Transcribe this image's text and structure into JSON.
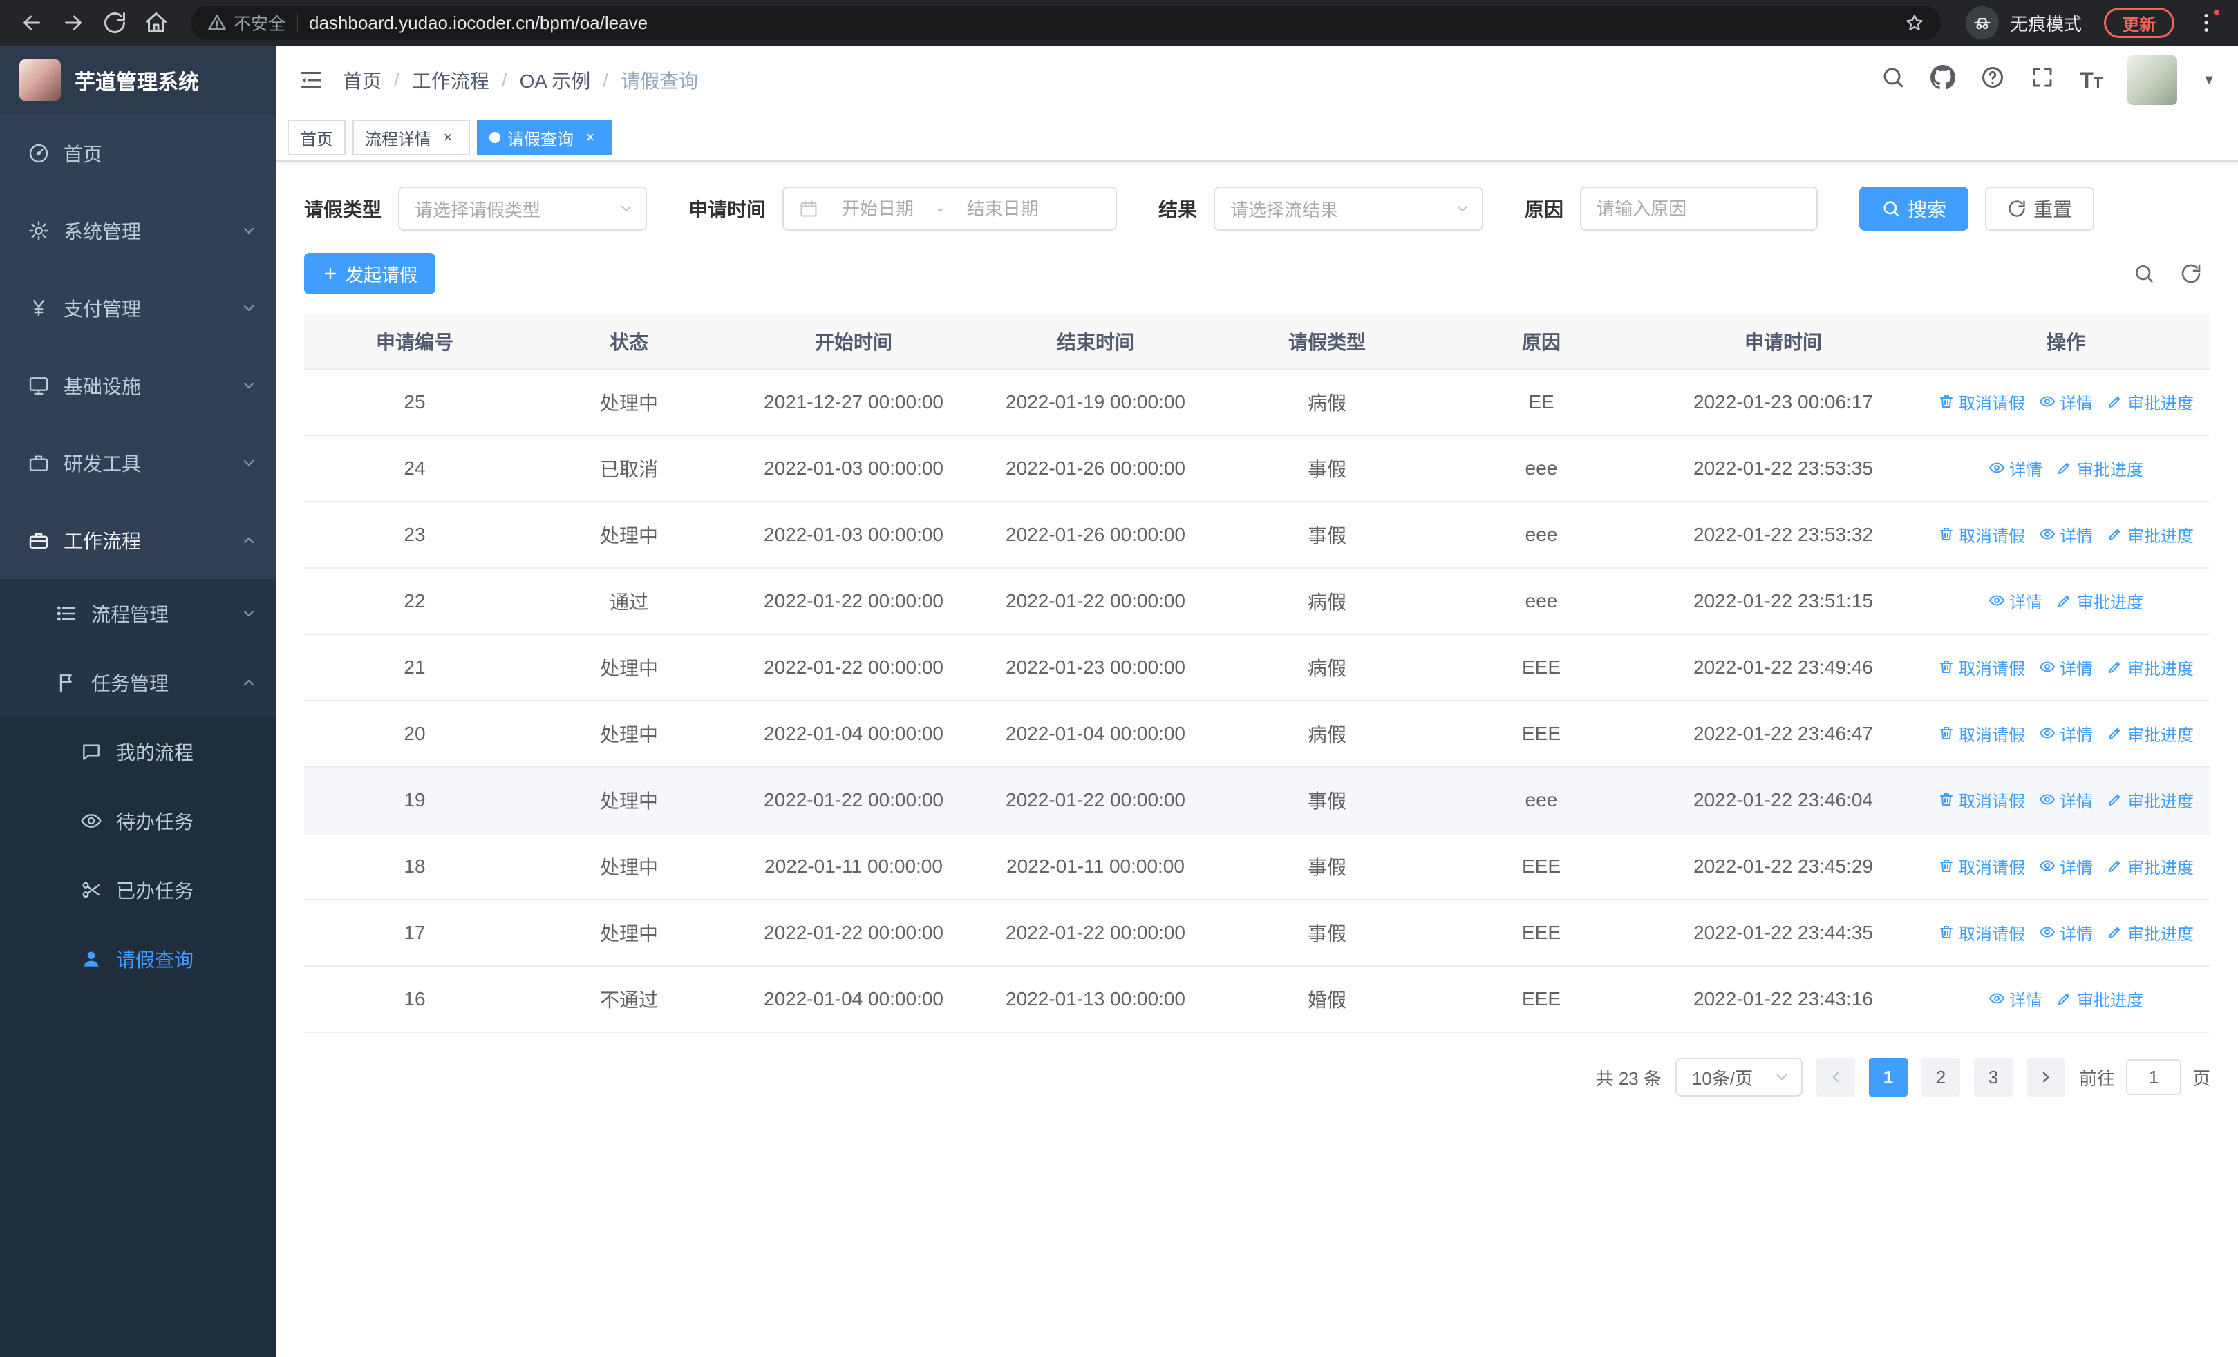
{
  "colors": {
    "accent": "#409eff",
    "sidebar_bg": "#1f2d3d",
    "sidebar_item_bg": "#304156",
    "chrome_bg": "#242528",
    "update_red": "#ee675c"
  },
  "browser": {
    "security_label": "不安全",
    "url": "dashboard.yudao.iocoder.cn/bpm/oa/leave",
    "incognito_label": "无痕模式",
    "update_label": "更新"
  },
  "sidebar": {
    "logo_title": "芋道管理系统",
    "items": [
      "首页",
      "系统管理",
      "支付管理",
      "基础设施",
      "研发工具",
      "工作流程",
      "流程管理",
      "任务管理",
      "我的流程",
      "待办任务",
      "已办任务",
      "请假查询"
    ]
  },
  "header": {
    "breadcrumb": [
      "首页",
      "工作流程",
      "OA 示例",
      "请假查询"
    ]
  },
  "tabs": [
    {
      "label": "首页"
    },
    {
      "label": "流程详情"
    },
    {
      "label": "请假查询"
    }
  ],
  "filters": {
    "leave_type": {
      "label": "请假类型",
      "placeholder": "请选择请假类型"
    },
    "apply_time": {
      "label": "申请时间",
      "start_placeholder": "开始日期",
      "separator": "-",
      "end_placeholder": "结束日期"
    },
    "result": {
      "label": "结果",
      "placeholder": "请选择流结果"
    },
    "reason": {
      "label": "原因",
      "placeholder": "请输入原因"
    },
    "search_label": "搜索",
    "reset_label": "重置"
  },
  "toolbar": {
    "create_label": "发起请假"
  },
  "table": {
    "columns": [
      "申请编号",
      "状态",
      "开始时间",
      "结束时间",
      "请假类型",
      "原因",
      "申请时间",
      "操作"
    ],
    "action_labels": {
      "cancel": "取消请假",
      "detail": "详情",
      "progress": "审批进度"
    },
    "rows": [
      {
        "id": "25",
        "status": "处理中",
        "start": "2021-12-27 00:00:00",
        "end": "2022-01-19 00:00:00",
        "type": "病假",
        "reason": "EE",
        "applied": "2022-01-23 00:06:17",
        "cancelable": true,
        "highlighted": false
      },
      {
        "id": "24",
        "status": "已取消",
        "start": "2022-01-03 00:00:00",
        "end": "2022-01-26 00:00:00",
        "type": "事假",
        "reason": "eee",
        "applied": "2022-01-22 23:53:35",
        "cancelable": false,
        "highlighted": false
      },
      {
        "id": "23",
        "status": "处理中",
        "start": "2022-01-03 00:00:00",
        "end": "2022-01-26 00:00:00",
        "type": "事假",
        "reason": "eee",
        "applied": "2022-01-22 23:53:32",
        "cancelable": true,
        "highlighted": false
      },
      {
        "id": "22",
        "status": "通过",
        "start": "2022-01-22 00:00:00",
        "end": "2022-01-22 00:00:00",
        "type": "病假",
        "reason": "eee",
        "applied": "2022-01-22 23:51:15",
        "cancelable": false,
        "highlighted": false
      },
      {
        "id": "21",
        "status": "处理中",
        "start": "2022-01-22 00:00:00",
        "end": "2022-01-23 00:00:00",
        "type": "病假",
        "reason": "EEE",
        "applied": "2022-01-22 23:49:46",
        "cancelable": true,
        "highlighted": false
      },
      {
        "id": "20",
        "status": "处理中",
        "start": "2022-01-04 00:00:00",
        "end": "2022-01-04 00:00:00",
        "type": "病假",
        "reason": "EEE",
        "applied": "2022-01-22 23:46:47",
        "cancelable": true,
        "highlighted": false
      },
      {
        "id": "19",
        "status": "处理中",
        "start": "2022-01-22 00:00:00",
        "end": "2022-01-22 00:00:00",
        "type": "事假",
        "reason": "eee",
        "applied": "2022-01-22 23:46:04",
        "cancelable": true,
        "highlighted": true
      },
      {
        "id": "18",
        "status": "处理中",
        "start": "2022-01-11 00:00:00",
        "end": "2022-01-11 00:00:00",
        "type": "事假",
        "reason": "EEE",
        "applied": "2022-01-22 23:45:29",
        "cancelable": true,
        "highlighted": false
      },
      {
        "id": "17",
        "status": "处理中",
        "start": "2022-01-22 00:00:00",
        "end": "2022-01-22 00:00:00",
        "type": "事假",
        "reason": "EEE",
        "applied": "2022-01-22 23:44:35",
        "cancelable": true,
        "highlighted": false
      },
      {
        "id": "16",
        "status": "不通过",
        "start": "2022-01-04 00:00:00",
        "end": "2022-01-13 00:00:00",
        "type": "婚假",
        "reason": "EEE",
        "applied": "2022-01-22 23:43:16",
        "cancelable": false,
        "highlighted": false
      }
    ]
  },
  "pagination": {
    "total_label": "共 23 条",
    "page_size": "10条/页",
    "pages": [
      "1",
      "2",
      "3"
    ],
    "active_page": "1",
    "goto_prefix": "前往",
    "goto_value": "1",
    "goto_suffix": "页"
  },
  "icons": {
    "chrome": [
      "back-icon",
      "forward-icon",
      "reload-icon",
      "browser-home-icon",
      "warning-icon",
      "star-icon",
      "incognito-icon",
      "kebab-menu-icon"
    ],
    "navbar": [
      "collapse-sidebar-icon",
      "search-icon",
      "github-icon",
      "help-icon",
      "fullscreen-icon",
      "font-size-icon"
    ],
    "sidebar": [
      "dashboard-icon",
      "gear-icon",
      "yen-icon",
      "infrastructure-icon",
      "tools-icon",
      "workflow-icon",
      "process-list-icon",
      "task-flag-icon",
      "chat-icon",
      "eye-icon",
      "done-tasks-icon",
      "user-icon"
    ],
    "actions": [
      "trash-icon",
      "eye-icon",
      "edit-icon"
    ]
  }
}
